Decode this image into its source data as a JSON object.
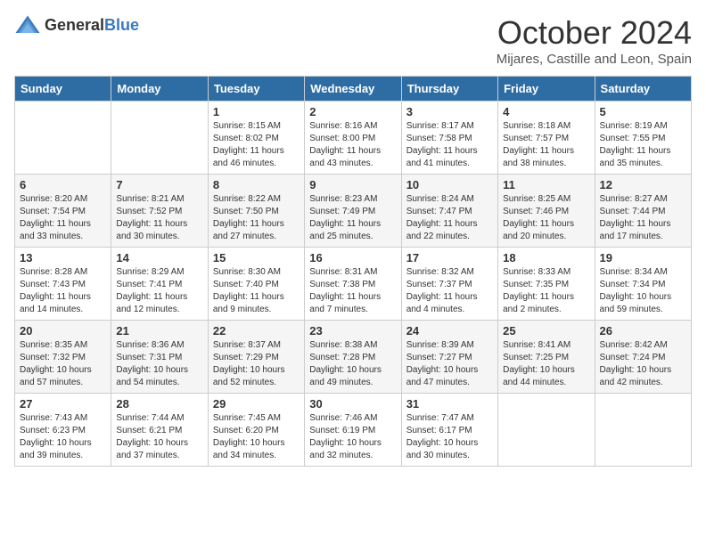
{
  "header": {
    "logo_general": "General",
    "logo_blue": "Blue",
    "month": "October 2024",
    "location": "Mijares, Castille and Leon, Spain"
  },
  "weekdays": [
    "Sunday",
    "Monday",
    "Tuesday",
    "Wednesday",
    "Thursday",
    "Friday",
    "Saturday"
  ],
  "weeks": [
    [
      {
        "day": "",
        "info": ""
      },
      {
        "day": "",
        "info": ""
      },
      {
        "day": "1",
        "info": "Sunrise: 8:15 AM\nSunset: 8:02 PM\nDaylight: 11 hours and 46 minutes."
      },
      {
        "day": "2",
        "info": "Sunrise: 8:16 AM\nSunset: 8:00 PM\nDaylight: 11 hours and 43 minutes."
      },
      {
        "day": "3",
        "info": "Sunrise: 8:17 AM\nSunset: 7:58 PM\nDaylight: 11 hours and 41 minutes."
      },
      {
        "day": "4",
        "info": "Sunrise: 8:18 AM\nSunset: 7:57 PM\nDaylight: 11 hours and 38 minutes."
      },
      {
        "day": "5",
        "info": "Sunrise: 8:19 AM\nSunset: 7:55 PM\nDaylight: 11 hours and 35 minutes."
      }
    ],
    [
      {
        "day": "6",
        "info": "Sunrise: 8:20 AM\nSunset: 7:54 PM\nDaylight: 11 hours and 33 minutes."
      },
      {
        "day": "7",
        "info": "Sunrise: 8:21 AM\nSunset: 7:52 PM\nDaylight: 11 hours and 30 minutes."
      },
      {
        "day": "8",
        "info": "Sunrise: 8:22 AM\nSunset: 7:50 PM\nDaylight: 11 hours and 27 minutes."
      },
      {
        "day": "9",
        "info": "Sunrise: 8:23 AM\nSunset: 7:49 PM\nDaylight: 11 hours and 25 minutes."
      },
      {
        "day": "10",
        "info": "Sunrise: 8:24 AM\nSunset: 7:47 PM\nDaylight: 11 hours and 22 minutes."
      },
      {
        "day": "11",
        "info": "Sunrise: 8:25 AM\nSunset: 7:46 PM\nDaylight: 11 hours and 20 minutes."
      },
      {
        "day": "12",
        "info": "Sunrise: 8:27 AM\nSunset: 7:44 PM\nDaylight: 11 hours and 17 minutes."
      }
    ],
    [
      {
        "day": "13",
        "info": "Sunrise: 8:28 AM\nSunset: 7:43 PM\nDaylight: 11 hours and 14 minutes."
      },
      {
        "day": "14",
        "info": "Sunrise: 8:29 AM\nSunset: 7:41 PM\nDaylight: 11 hours and 12 minutes."
      },
      {
        "day": "15",
        "info": "Sunrise: 8:30 AM\nSunset: 7:40 PM\nDaylight: 11 hours and 9 minutes."
      },
      {
        "day": "16",
        "info": "Sunrise: 8:31 AM\nSunset: 7:38 PM\nDaylight: 11 hours and 7 minutes."
      },
      {
        "day": "17",
        "info": "Sunrise: 8:32 AM\nSunset: 7:37 PM\nDaylight: 11 hours and 4 minutes."
      },
      {
        "day": "18",
        "info": "Sunrise: 8:33 AM\nSunset: 7:35 PM\nDaylight: 11 hours and 2 minutes."
      },
      {
        "day": "19",
        "info": "Sunrise: 8:34 AM\nSunset: 7:34 PM\nDaylight: 10 hours and 59 minutes."
      }
    ],
    [
      {
        "day": "20",
        "info": "Sunrise: 8:35 AM\nSunset: 7:32 PM\nDaylight: 10 hours and 57 minutes."
      },
      {
        "day": "21",
        "info": "Sunrise: 8:36 AM\nSunset: 7:31 PM\nDaylight: 10 hours and 54 minutes."
      },
      {
        "day": "22",
        "info": "Sunrise: 8:37 AM\nSunset: 7:29 PM\nDaylight: 10 hours and 52 minutes."
      },
      {
        "day": "23",
        "info": "Sunrise: 8:38 AM\nSunset: 7:28 PM\nDaylight: 10 hours and 49 minutes."
      },
      {
        "day": "24",
        "info": "Sunrise: 8:39 AM\nSunset: 7:27 PM\nDaylight: 10 hours and 47 minutes."
      },
      {
        "day": "25",
        "info": "Sunrise: 8:41 AM\nSunset: 7:25 PM\nDaylight: 10 hours and 44 minutes."
      },
      {
        "day": "26",
        "info": "Sunrise: 8:42 AM\nSunset: 7:24 PM\nDaylight: 10 hours and 42 minutes."
      }
    ],
    [
      {
        "day": "27",
        "info": "Sunrise: 7:43 AM\nSunset: 6:23 PM\nDaylight: 10 hours and 39 minutes."
      },
      {
        "day": "28",
        "info": "Sunrise: 7:44 AM\nSunset: 6:21 PM\nDaylight: 10 hours and 37 minutes."
      },
      {
        "day": "29",
        "info": "Sunrise: 7:45 AM\nSunset: 6:20 PM\nDaylight: 10 hours and 34 minutes."
      },
      {
        "day": "30",
        "info": "Sunrise: 7:46 AM\nSunset: 6:19 PM\nDaylight: 10 hours and 32 minutes."
      },
      {
        "day": "31",
        "info": "Sunrise: 7:47 AM\nSunset: 6:17 PM\nDaylight: 10 hours and 30 minutes."
      },
      {
        "day": "",
        "info": ""
      },
      {
        "day": "",
        "info": ""
      }
    ]
  ]
}
